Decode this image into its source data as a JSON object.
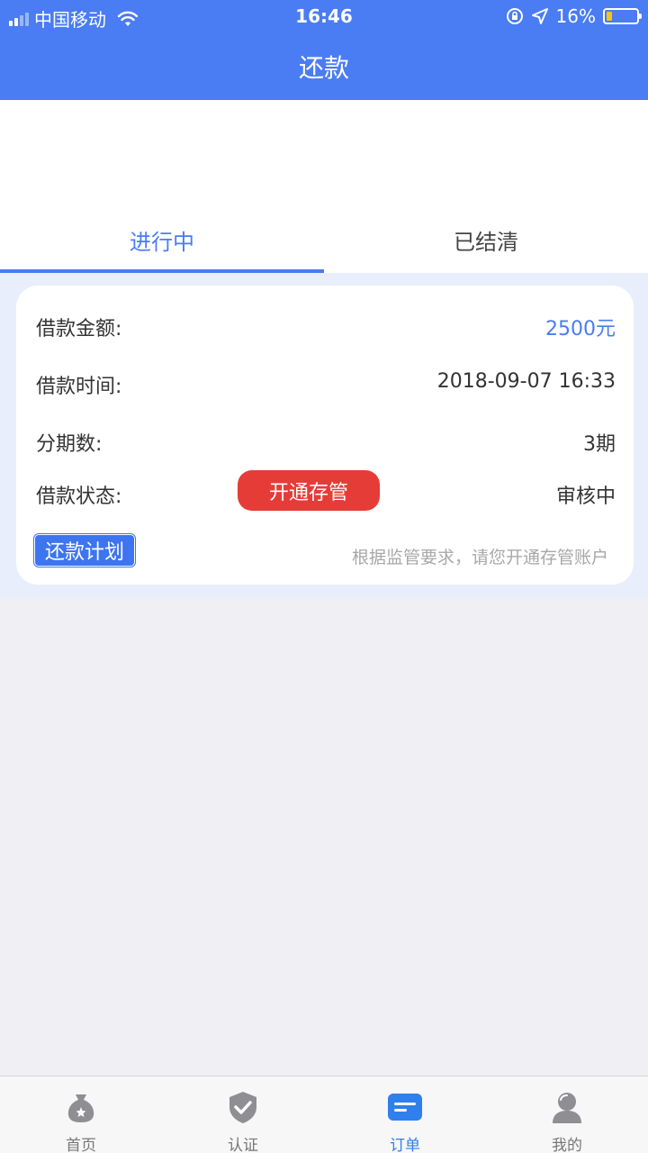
{
  "status_bar": {
    "carrier": "中国移动",
    "time": "16:46",
    "battery": "16%",
    "battery_level": 0.16
  },
  "nav": {
    "title": "还款"
  },
  "tabs": [
    {
      "label": "进行中",
      "active": true
    },
    {
      "label": "已结清",
      "active": false
    }
  ],
  "loan": {
    "amount_label": "借款金额:",
    "amount_value": "2500元",
    "time_label": "借款时间:",
    "time_value": "2018-09-07 16:33",
    "periods_label": "分期数:",
    "periods_value": "3期",
    "status_label": "借款状态:",
    "open_button": "开通存管",
    "status_value": "审核中",
    "plan_button": "还款计划",
    "hint": "根据监管要求，请您开通存管账户"
  },
  "tabbar": {
    "items": [
      {
        "label": "首页",
        "icon": "money-bag-icon",
        "active": false
      },
      {
        "label": "认证",
        "icon": "shield-check-icon",
        "active": false
      },
      {
        "label": "订单",
        "icon": "order-icon",
        "active": true
      },
      {
        "label": "我的",
        "icon": "user-icon",
        "active": false
      }
    ]
  },
  "colors": {
    "primary": "#4a7cf3",
    "danger": "#e63c38",
    "active_tab": "#2f80ed"
  }
}
